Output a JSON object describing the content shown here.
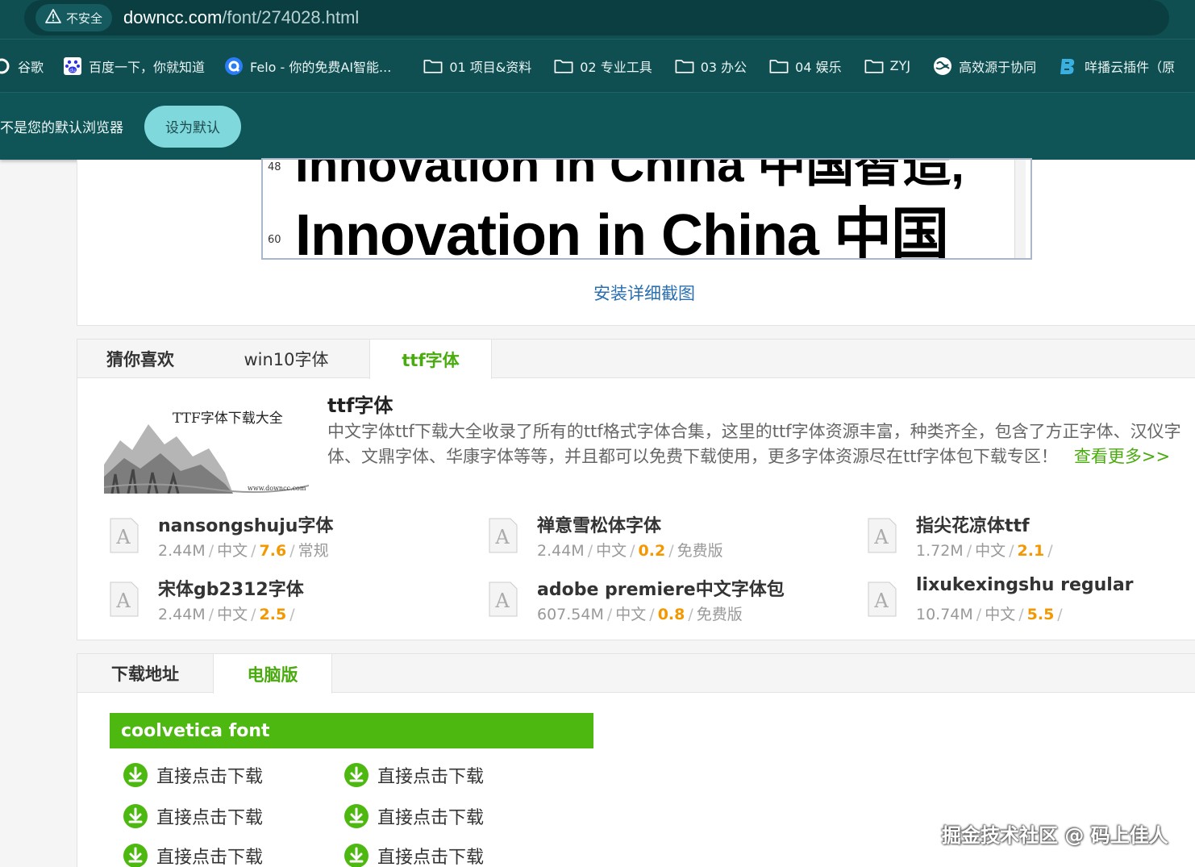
{
  "browser": {
    "security_label": "不安全",
    "url_host": "downcc.com",
    "url_path": "/font/274028.html"
  },
  "bookmarks": [
    {
      "label": "谷歌",
      "icon": "google-icon"
    },
    {
      "label": "百度一下，你就知道",
      "icon": "baidu-icon"
    },
    {
      "label": "Felo - 你的免费AI智能...",
      "icon": "felo-icon"
    },
    {
      "label": "01 项目&资料",
      "icon": "folder-icon"
    },
    {
      "label": "02 专业工具",
      "icon": "folder-icon"
    },
    {
      "label": "03 办公",
      "icon": "folder-icon"
    },
    {
      "label": "04 娱乐",
      "icon": "folder-icon"
    },
    {
      "label": "ZYJ",
      "icon": "folder-icon"
    },
    {
      "label": "高效源于协同",
      "icon": "globe-icon"
    },
    {
      "label": "咩播云插件（原",
      "icon": "miebo-icon"
    }
  ],
  "infobar": {
    "message": "不是您的默认浏览器",
    "button": "设为默认"
  },
  "preview": {
    "size_48": "48",
    "size_60": "60",
    "row1_text": "Innovation in China 中国智造,",
    "row2_text": "Innovation in China 中国",
    "install_link": "安装详细截图"
  },
  "guess": {
    "tabs": [
      "猜你喜欢",
      "win10字体",
      "ttf字体"
    ],
    "intro_image_caption": "TTF字体下载大全",
    "intro_image_site": "www.downcc.com",
    "intro_title": "ttf字体",
    "intro_desc": "中文字体ttf下载大全收录了所有的ttf格式字体合集，这里的ttf字体资源丰富，种类齐全，包含了方正字体、汉仪字体、文鼎字体、华康字体等等，并且都可以免费下载使用，更多字体资源尽在ttf字体包下载专区！",
    "intro_more": "查看更多>>",
    "fonts": [
      {
        "name": "nansongshuju字体",
        "size": "2.44M",
        "lang": "中文",
        "score": "7.6",
        "tag": "常规"
      },
      {
        "name": "禅意雪松体字体",
        "size": "2.44M",
        "lang": "中文",
        "score": "0.2",
        "tag": "免费版"
      },
      {
        "name": "指尖花凉体ttf",
        "size": "1.72M",
        "lang": "中文",
        "score": "2.1",
        "tag": ""
      },
      {
        "name": "宋体gb2312字体",
        "size": "2.44M",
        "lang": "中文",
        "score": "2.5",
        "tag": ""
      },
      {
        "name": "adobe premiere中文字体包",
        "size": "607.54M",
        "lang": "中文",
        "score": "0.8",
        "tag": "免费版"
      },
      {
        "name": "lixukexingshu regular",
        "size": "10.74M",
        "lang": "中文",
        "score": "5.5",
        "tag": ""
      }
    ]
  },
  "download": {
    "tabs": [
      "下载地址",
      "电脑版"
    ],
    "header": "coolvetica font",
    "links": [
      "直接点击下载",
      "直接点击下载",
      "直接点击下载",
      "直接点击下载",
      "直接点击下载",
      "直接点击下载"
    ]
  },
  "watermark": "掘金技术社区 @ 码上佳人",
  "colors": {
    "chrome": "#0f4f52",
    "accent_green": "#4aab0f",
    "score_orange": "#f39800",
    "link_blue": "#2a6fb0",
    "default_button": "#7fd8dc"
  }
}
